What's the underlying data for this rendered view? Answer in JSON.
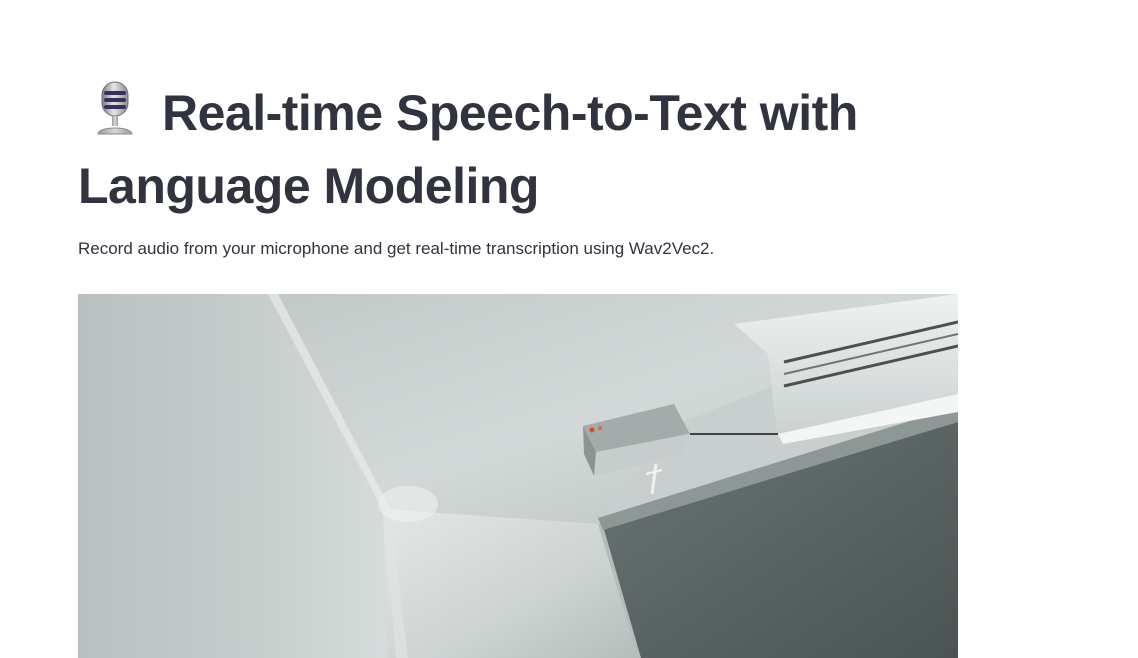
{
  "page": {
    "title": "Real-time Speech-to-Text with Language Modeling",
    "title_icon": "microphone-icon",
    "subtitle": "Record audio from your microphone and get real-time transcription using Wav2Vec2."
  },
  "video": {
    "content": "webcam-feed"
  },
  "colors": {
    "text": "#31333f",
    "background": "#ffffff"
  }
}
